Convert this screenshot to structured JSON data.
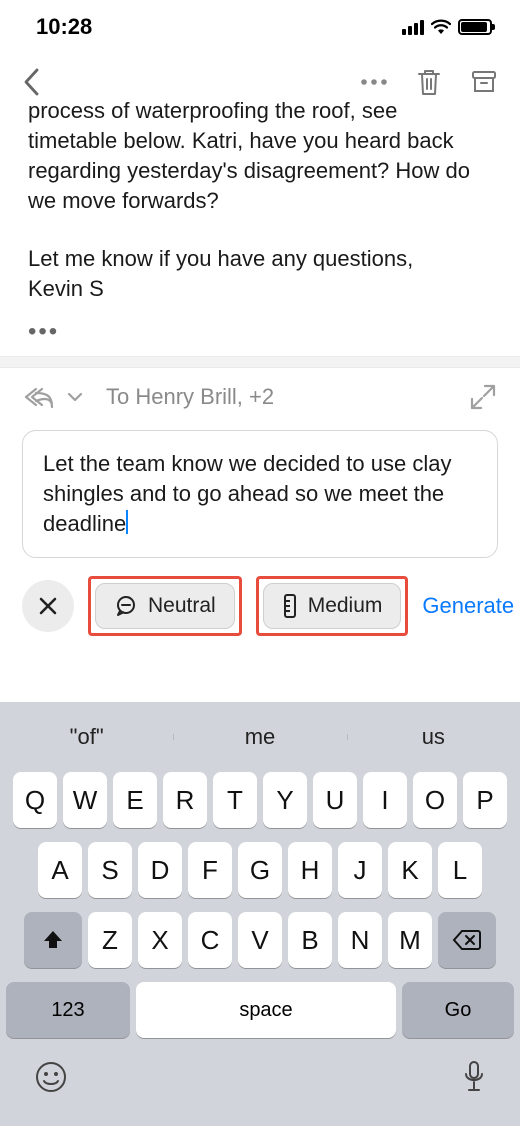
{
  "status": {
    "time": "10:28"
  },
  "email": {
    "body_cut": "process of waterproofing the roof, see timetable below. Katri, have you heard back regarding yesterday's disagreement? How do we move forwards?",
    "closing_line": "Let me know if you have any questions,",
    "sender": "Kevin S"
  },
  "reply": {
    "to_line": "To Henry Brill, +2"
  },
  "compose": {
    "text": "Let the team know we decided to use clay shingles and to go ahead so we meet the deadline"
  },
  "chips": {
    "tone": "Neutral",
    "length": "Medium",
    "generate": "Generate"
  },
  "keyboard": {
    "suggestions": [
      "\"of\"",
      "me",
      "us"
    ],
    "row1": [
      "Q",
      "W",
      "E",
      "R",
      "T",
      "Y",
      "U",
      "I",
      "O",
      "P"
    ],
    "row2": [
      "A",
      "S",
      "D",
      "F",
      "G",
      "H",
      "J",
      "K",
      "L"
    ],
    "row3": [
      "Z",
      "X",
      "C",
      "V",
      "B",
      "N",
      "M"
    ],
    "numbers": "123",
    "space": "space",
    "go": "Go"
  },
  "colors": {
    "accent": "#0a7aff",
    "highlight": "#e74c3c"
  }
}
